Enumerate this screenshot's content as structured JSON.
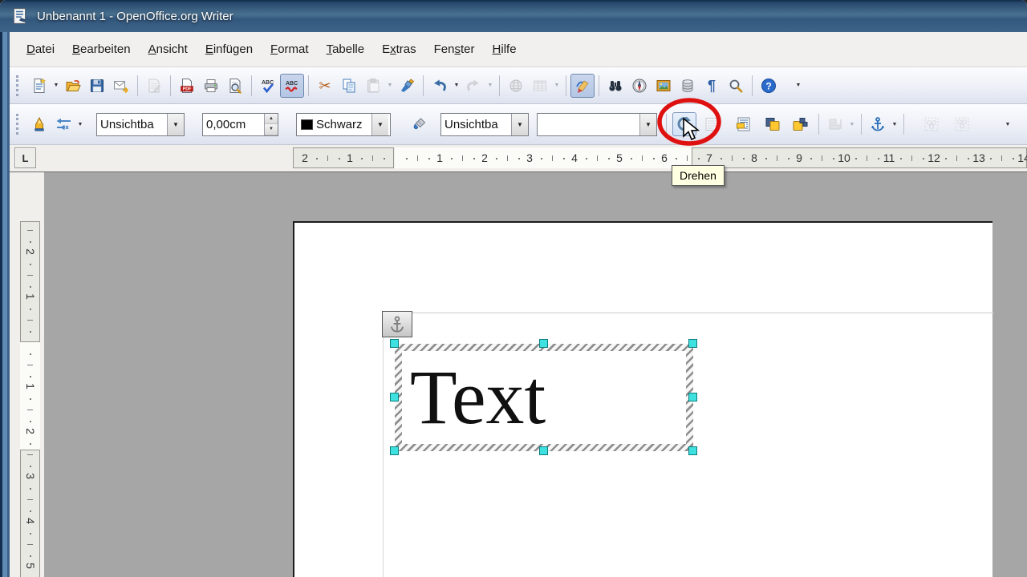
{
  "window": {
    "title": "Unbenannt 1 - OpenOffice.org Writer"
  },
  "menubar": {
    "items": [
      {
        "label": "Datei",
        "mnemonic_index": 0
      },
      {
        "label": "Bearbeiten",
        "mnemonic_index": 0
      },
      {
        "label": "Ansicht",
        "mnemonic_index": 0
      },
      {
        "label": "Einfügen",
        "mnemonic_index": 0
      },
      {
        "label": "Format",
        "mnemonic_index": 0
      },
      {
        "label": "Tabelle",
        "mnemonic_index": 0
      },
      {
        "label": "Extras",
        "mnemonic_index": 1
      },
      {
        "label": "Fenster",
        "mnemonic_index": 3
      },
      {
        "label": "Hilfe",
        "mnemonic_index": 0
      }
    ]
  },
  "toolbars": {
    "standard": {
      "buttons": [
        {
          "icon": "new-document",
          "dropdown": true
        },
        {
          "icon": "open"
        },
        {
          "icon": "save"
        },
        {
          "icon": "send-email"
        },
        {
          "icon": "edit-file",
          "disabled": true
        },
        {
          "icon": "export-pdf"
        },
        {
          "icon": "print"
        },
        {
          "icon": "page-preview"
        },
        {
          "icon": "spellcheck"
        },
        {
          "icon": "auto-spellcheck",
          "pressed": true
        },
        {
          "icon": "cut"
        },
        {
          "icon": "copy"
        },
        {
          "icon": "paste",
          "disabled": true,
          "dropdown": true
        },
        {
          "icon": "format-paintbrush"
        },
        {
          "icon": "undo",
          "dropdown": true
        },
        {
          "icon": "redo",
          "disabled": true,
          "dropdown": true
        },
        {
          "icon": "hyperlink",
          "disabled": true
        },
        {
          "icon": "insert-table",
          "disabled": true,
          "dropdown": true
        },
        {
          "icon": "show-draw-functions",
          "pressed": true
        },
        {
          "icon": "find-replace"
        },
        {
          "icon": "navigator"
        },
        {
          "icon": "gallery"
        },
        {
          "icon": "data-sources"
        },
        {
          "icon": "nonprinting-characters"
        },
        {
          "icon": "zoom"
        },
        {
          "icon": "help"
        }
      ]
    },
    "object_properties": {
      "line_style": {
        "value": "Unsichtba"
      },
      "line_width": {
        "value": "0,00cm"
      },
      "line_color": {
        "value": "Schwarz",
        "swatch": "#000000"
      },
      "area_style": {
        "value": "Unsichtba"
      },
      "fill_color": {
        "value": ""
      },
      "buttons": [
        {
          "icon": "line-dialog"
        },
        {
          "icon": "arrow-style",
          "dropdown": true
        },
        {
          "icon": "area-fill"
        },
        {
          "icon": "rotate",
          "hovered": true
        },
        {
          "icon": "wrap-contour",
          "disabled": true
        },
        {
          "icon": "wrap"
        },
        {
          "icon": "bring-to-front"
        },
        {
          "icon": "send-to-back"
        },
        {
          "icon": "alignment",
          "disabled": true,
          "dropdown": true
        },
        {
          "icon": "anchor",
          "dropdown": true
        },
        {
          "icon": "group",
          "disabled": true
        },
        {
          "icon": "ungroup",
          "disabled": true
        }
      ]
    }
  },
  "glyphs": {
    "spell_abc": "ABC",
    "pdf": "PDF",
    "help": "?",
    "pilcrow": "¶",
    "cut": "✂"
  },
  "tooltip": {
    "text": "Drehen"
  },
  "rulers": {
    "tab_selector": "L",
    "horizontal": {
      "before_origin": [
        "1",
        "2"
      ],
      "after_origin": [
        "1",
        "2",
        "3",
        "4",
        "5",
        "6",
        "7",
        "8",
        "9",
        "10",
        "11",
        "12",
        "13",
        "14"
      ]
    },
    "vertical": {
      "before_origin": [
        "1",
        "2"
      ],
      "after_origin": [
        "1",
        "2",
        "3",
        "4",
        "5"
      ]
    }
  },
  "document": {
    "frame_text": "Text"
  },
  "annotation": {
    "highlight_color": "#DE1010"
  },
  "colors": {
    "titlebar_blue": "#33587E",
    "workspace_gray": "#A6A6A6",
    "selection_handle": "#3FE0E0",
    "tooltip_bg": "#FFFFE1"
  }
}
